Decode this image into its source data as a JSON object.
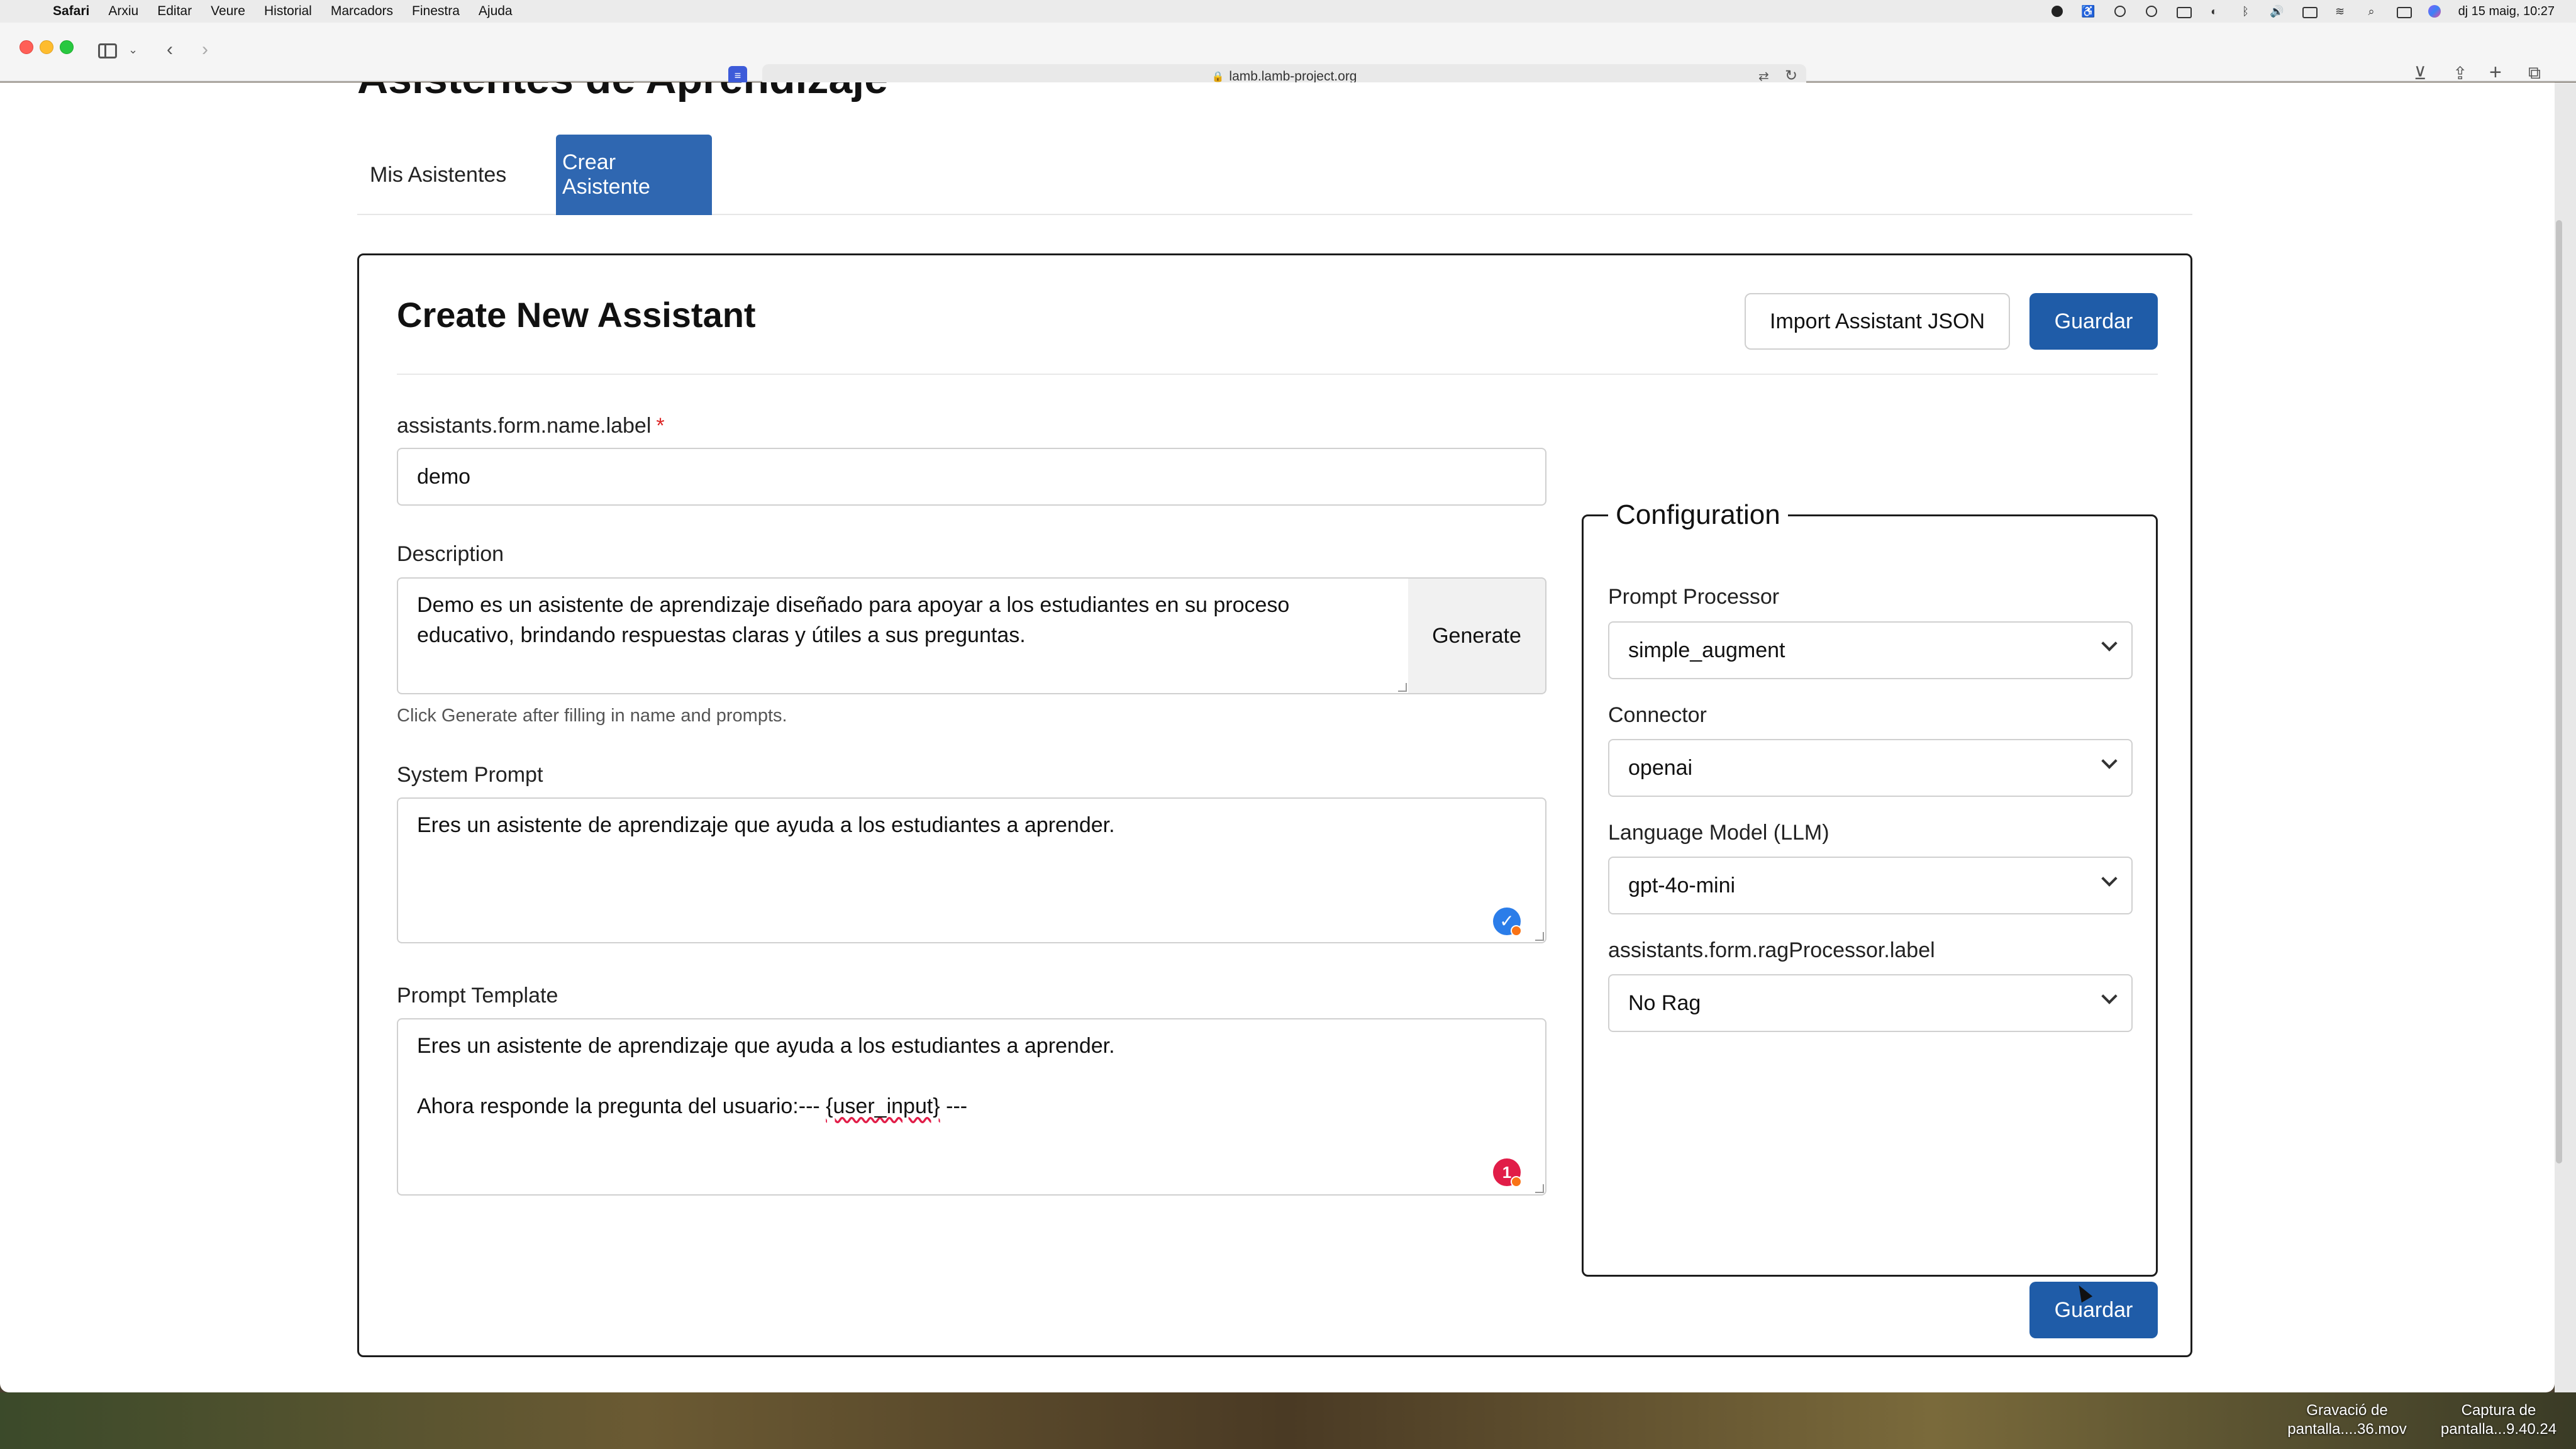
{
  "menubar": {
    "items": [
      "Safari",
      "Arxiu",
      "Editar",
      "Veure",
      "Historial",
      "Marcadors",
      "Finestra",
      "Ajuda"
    ],
    "clock": "dj 15 maig, 10:27"
  },
  "browser": {
    "url": "lamb.lamb-project.org"
  },
  "page": {
    "heading": "Asistentes de Aprendizaje",
    "tabs": [
      "Mis Asistentes",
      "Crear Asistente"
    ],
    "active_tab": "Crear Asistente"
  },
  "form": {
    "title": "Create New Assistant",
    "import_label": "Import Assistant JSON",
    "save_label": "Guardar",
    "name_label": "assistants.form.name.label",
    "required_mark": "*",
    "name_value": "demo",
    "description_label": "Description",
    "description_value": "Demo es un asistente de aprendizaje diseñado para apoyar a los estudiantes en su proceso educativo, brindando respuestas claras y útiles a sus preguntas.",
    "generate_label": "Generate",
    "description_hint": "Click Generate after filling in name and prompts.",
    "system_prompt_label": "System Prompt",
    "system_prompt_value": "Eres un asistente de aprendizaje que ayuda a los estudiantes a aprender.",
    "prompt_template_label": "Prompt Template",
    "prompt_template_line1": "Eres un asistente de aprendizaje que ayuda a los estudiantes a aprender.",
    "prompt_template_line2_prefix": "Ahora responde la pregunta del usuario:--- ",
    "prompt_template_line2_var": "{user_input}",
    "prompt_template_line2_suffix": " ---",
    "error_count": "1"
  },
  "configuration": {
    "legend": "Configuration",
    "prompt_processor_label": "Prompt Processor",
    "prompt_processor_value": "simple_augment",
    "connector_label": "Connector",
    "connector_value": "openai",
    "llm_label": "Language Model (LLM)",
    "llm_value": "gpt-4o-mini",
    "rag_label": "assistants.form.ragProcessor.label",
    "rag_value": "No Rag"
  },
  "desktop": {
    "file1": [
      "Gravació de",
      "pantalla....36.mov"
    ],
    "file2": [
      "Captura de",
      "pantalla...9.40.24"
    ]
  },
  "colors": {
    "accent": "#1f5ca8",
    "tab_active": "#2f67b1",
    "error": "#e11d48",
    "required": "#dc2626"
  }
}
